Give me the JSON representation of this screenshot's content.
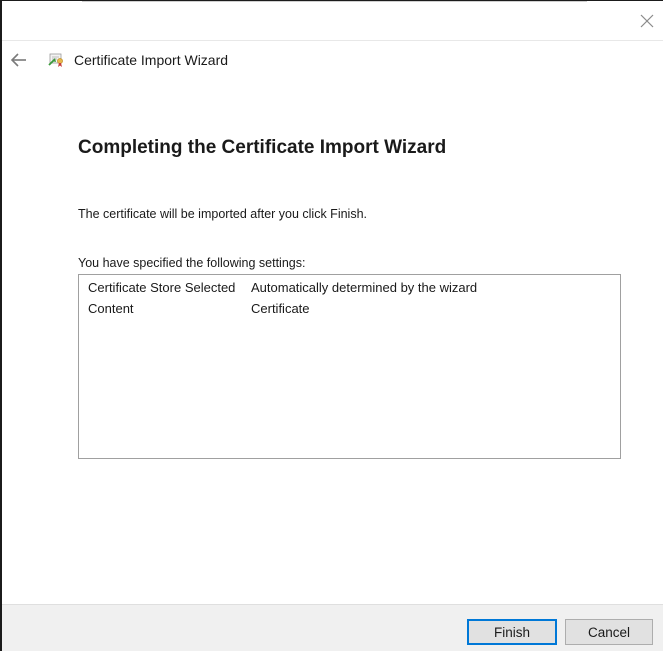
{
  "window": {
    "title": "Certificate Import Wizard",
    "icons": {
      "close": "close-icon",
      "back": "back-arrow-icon",
      "wizard": "certificate-icon"
    }
  },
  "page": {
    "heading": "Completing the Certificate Import Wizard",
    "info": "The certificate will be imported after you click Finish.",
    "settings_label": "You have specified the following settings:",
    "settings": [
      {
        "key": "Certificate Store Selected",
        "value": "Automatically determined by the wizard"
      },
      {
        "key": "Content",
        "value": "Certificate"
      }
    ]
  },
  "footer": {
    "finish_label": "Finish",
    "cancel_label": "Cancel"
  },
  "colors": {
    "accent": "#0078d7",
    "footer_bg": "#f0f0f0",
    "border": "#a0a0a0"
  }
}
